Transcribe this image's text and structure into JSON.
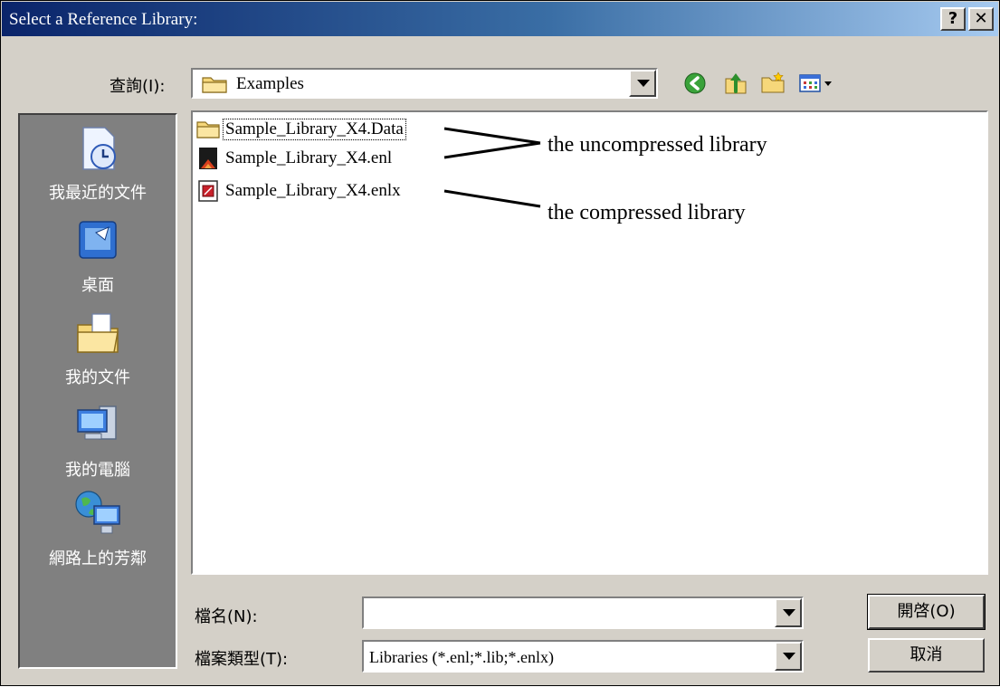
{
  "window": {
    "title": "Select a Reference Library:"
  },
  "titlebar_buttons": {
    "help": "?",
    "close": "✕"
  },
  "lookin": {
    "label": "查詢(I):",
    "value": "Examples"
  },
  "toolbar": [
    "back-icon",
    "up-folder-icon",
    "new-folder-icon",
    "view-menu-icon"
  ],
  "places": [
    {
      "label": "我最近的文件",
      "icon": "recent-documents-icon"
    },
    {
      "label": "桌面",
      "icon": "desktop-icon"
    },
    {
      "label": "我的文件",
      "icon": "my-documents-icon"
    },
    {
      "label": "我的電腦",
      "icon": "my-computer-icon"
    },
    {
      "label": "網路上的芳鄰",
      "icon": "network-places-icon"
    }
  ],
  "files": [
    {
      "name": "Sample_Library_X4.Data",
      "icon": "folder-icon",
      "focused": true
    },
    {
      "name": "Sample_Library_X4.enl",
      "icon": "endnote-library-icon",
      "focused": false
    },
    {
      "name": "Sample_Library_X4.enlx",
      "icon": "compressed-library-icon",
      "focused": false
    }
  ],
  "annotations": {
    "uncompressed": "the uncompressed library",
    "compressed": "the compressed library"
  },
  "filename": {
    "label": "檔名(N):",
    "value": ""
  },
  "filetype": {
    "label": "檔案類型(T):",
    "value": "Libraries (*.enl;*.lib;*.enlx)"
  },
  "buttons": {
    "open": "開啓(O)",
    "cancel": "取消"
  }
}
